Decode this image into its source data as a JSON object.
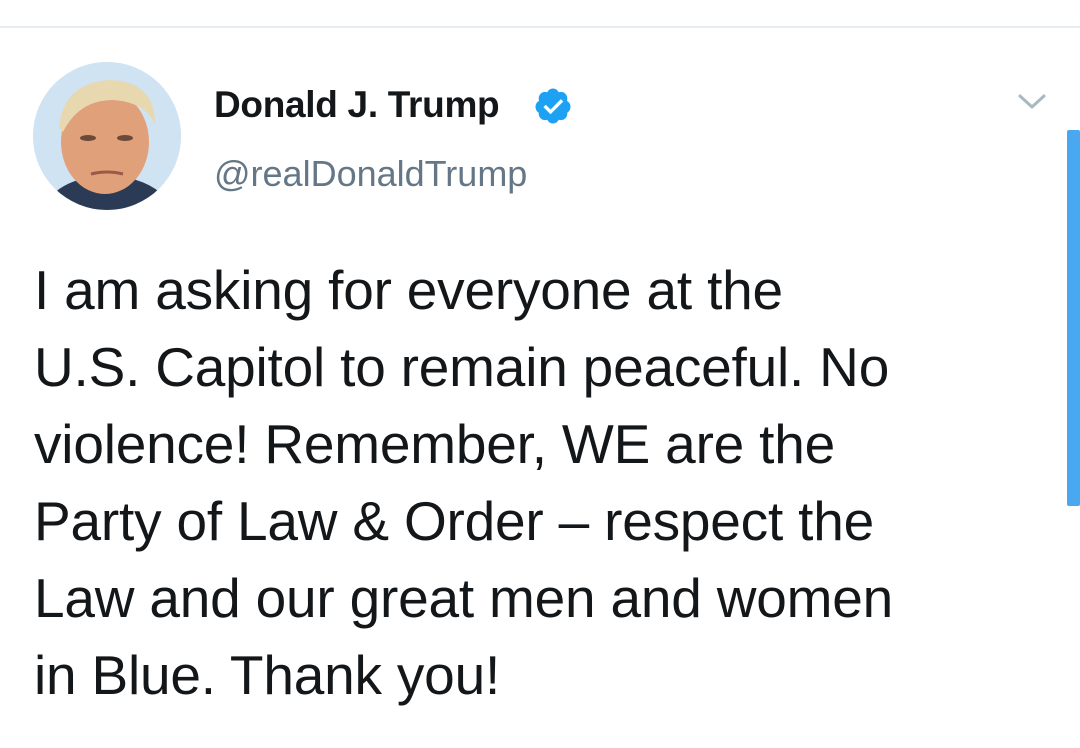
{
  "tweet": {
    "author": {
      "display_name": "Donald J. Trump",
      "handle": "@realDonaldTrump",
      "verified": true,
      "avatar_icon": "profile-photo"
    },
    "text": "I am asking for everyone at the\nU.S. Capitol to remain peaceful. No\nviolence! Remember, WE are the\nParty of Law & Order – respect the\nLaw and our great men and women\nin Blue. Thank you!",
    "menu_icon": "chevron-down-icon"
  },
  "colors": {
    "text": "#14171a",
    "handle": "#657786",
    "verified": "#1da1f2",
    "scrollbar": "#4aa8f0",
    "divider": "#e6ecf0"
  }
}
